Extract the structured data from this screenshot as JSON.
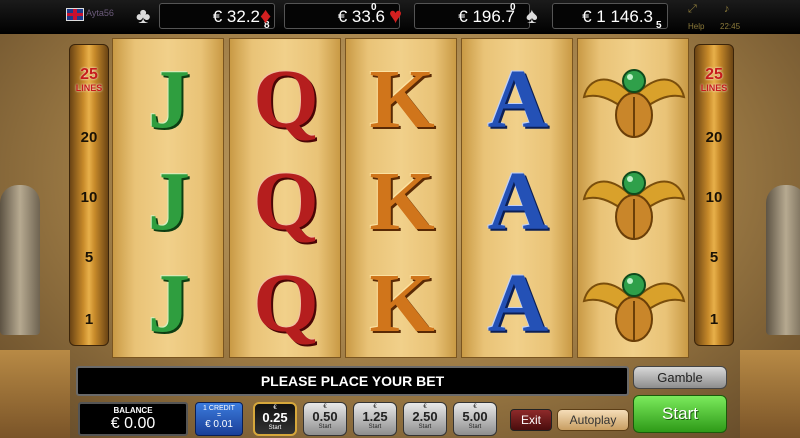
{
  "topbar": {
    "player_name": "Ayta56",
    "jackpots": [
      {
        "suit": "clubs",
        "icon": "♣",
        "value": "€ 32.2",
        "suffix": "8"
      },
      {
        "suit": "diamonds",
        "icon": "♦",
        "value": "€ 33.6",
        "suffix": "0"
      },
      {
        "suit": "hearts",
        "icon": "♥",
        "value": "€ 196.7",
        "suffix": "0"
      },
      {
        "suit": "spades",
        "icon": "♠",
        "value": "€ 1 146.3",
        "suffix": "5"
      }
    ],
    "help_label": "Help",
    "clock": "22:45",
    "fullscreen_icon": "expand-icon",
    "sound_icon": "sound-icon"
  },
  "lines_panel": {
    "total": "25",
    "total_label": "LINES",
    "markers": [
      "20",
      "10",
      "5",
      "1"
    ]
  },
  "reels": [
    [
      "J",
      "J",
      "J"
    ],
    [
      "Q",
      "Q",
      "Q"
    ],
    [
      "K",
      "K",
      "K"
    ],
    [
      "A",
      "A",
      "A"
    ],
    [
      "scarab",
      "scarab",
      "scarab"
    ]
  ],
  "message": "PLEASE PLACE YOUR BET",
  "gamble_label": "Gamble",
  "balance": {
    "label": "BALANCE",
    "value": "€ 0.00"
  },
  "credit": {
    "line1": "1 CREDIT",
    "line2": "=",
    "value": "€ 0.01"
  },
  "bets": [
    {
      "currency": "€",
      "value": "0.25",
      "sub": "Start",
      "selected": true
    },
    {
      "currency": "€",
      "value": "0.50",
      "sub": "Start",
      "selected": false
    },
    {
      "currency": "€",
      "value": "1.25",
      "sub": "Start",
      "selected": false
    },
    {
      "currency": "€",
      "value": "2.50",
      "sub": "Start",
      "selected": false
    },
    {
      "currency": "€",
      "value": "5.00",
      "sub": "Start",
      "selected": false
    }
  ],
  "exit_label": "Exit",
  "autoplay_label": "Autoplay",
  "start_label": "Start"
}
